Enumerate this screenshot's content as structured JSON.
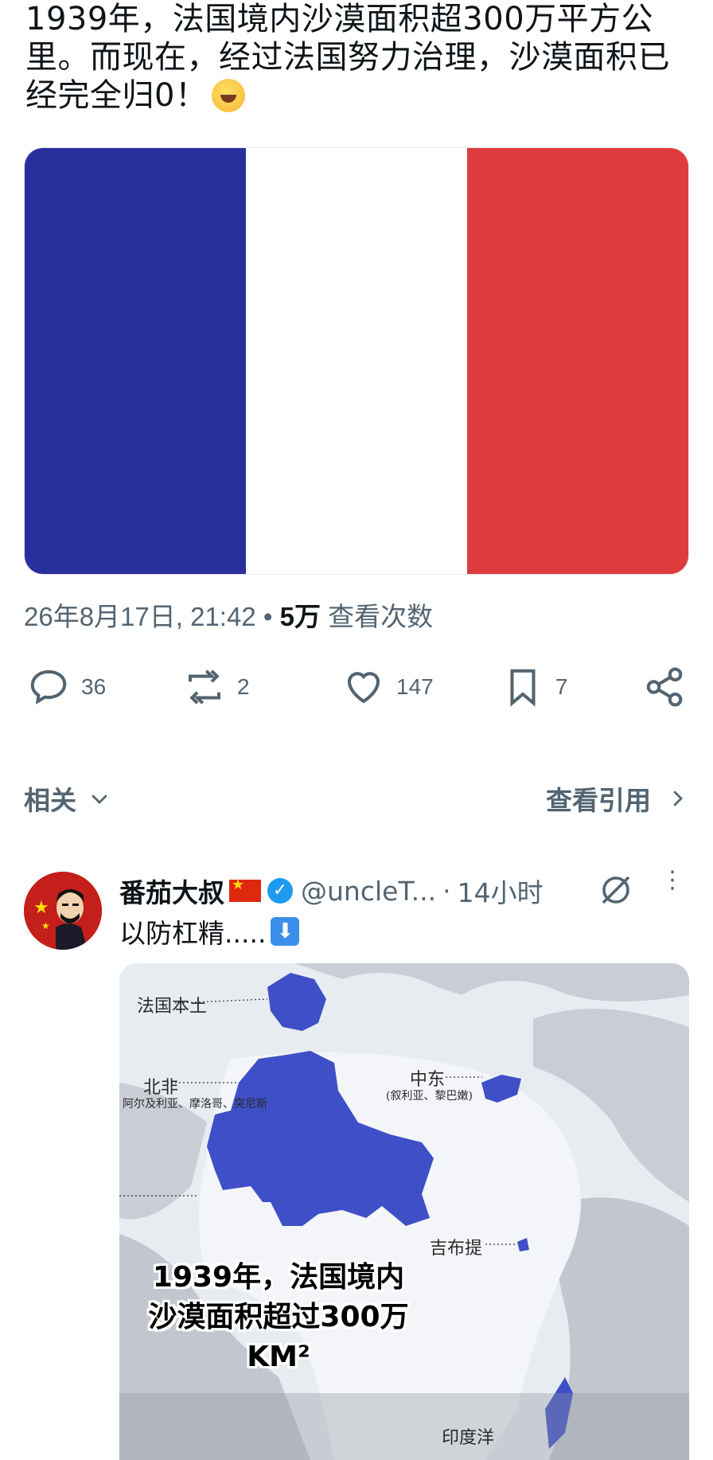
{
  "post": {
    "text": "1939年，法国境内沙漠面积超300万平方公里。而现在，经过法国努力治理，沙漠面积已经完全归0！",
    "emoji": "rolling-on-floor-laughing-emoji",
    "flag_colors": [
      "#2a2f9e",
      "#ffffff",
      "#de3b3f"
    ],
    "timestamp": "26年8月17日, 21:42",
    "separator": "•",
    "views_count": "5万",
    "views_label": "查看次数"
  },
  "actions": {
    "replies": "36",
    "reposts": "2",
    "likes": "147",
    "bookmarks": "7"
  },
  "related": {
    "label": "相关",
    "quotes_label": "查看引用"
  },
  "reply": {
    "name": "番茄大叔",
    "handle": "@uncleT...",
    "separator": "·",
    "time": "14小时",
    "text": "以防杠精.....",
    "map": {
      "labels": {
        "france": "法国本土",
        "north_africa": "北非",
        "north_africa_sub": "阿尔及利亚、摩洛哥、突尼斯",
        "middle_east": "中东",
        "middle_east_sub": "(叙利亚、黎巴嫩)",
        "djibouti": "吉布提",
        "indochina": "印度洋"
      },
      "caption_line1": "1939年，法国境内",
      "caption_line2": "沙漠面积超过300万",
      "caption_line3": "KM²"
    }
  },
  "colors": {
    "text_primary": "#0f1419",
    "text_secondary": "#536471",
    "verified": "#1d9bf0",
    "map_fill": "#3f4fc7"
  }
}
